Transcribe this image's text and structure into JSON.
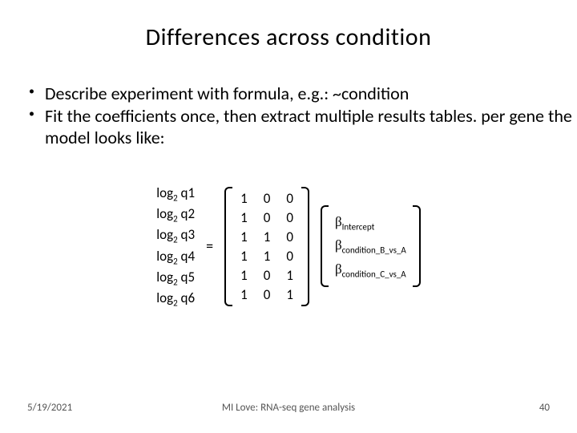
{
  "title": "Differences across condition",
  "bullets": [
    "Describe experiment with formula, e.g.: ~condition",
    "Fit the coefficients once, then extract multiple results tables. per gene the model looks like:"
  ],
  "logvec": {
    "base_label": "log",
    "base_sub": "2",
    "items": [
      "q1",
      "q2",
      "q3",
      "q4",
      "q5",
      "q6"
    ]
  },
  "equals": "=",
  "matrix": {
    "cols": [
      [
        "1",
        "1",
        "1",
        "1",
        "1",
        "1"
      ],
      [
        "0",
        "0",
        "1",
        "1",
        "0",
        "0"
      ],
      [
        "0",
        "0",
        "0",
        "0",
        "1",
        "1"
      ]
    ]
  },
  "betas": {
    "symbol": "β",
    "subs": [
      "Intercept",
      "condition_B_vs_A",
      "condition_C_vs_A"
    ]
  },
  "footer": {
    "date": "5/19/2021",
    "center": "MI Love: RNA-seq gene analysis",
    "page": "40"
  }
}
